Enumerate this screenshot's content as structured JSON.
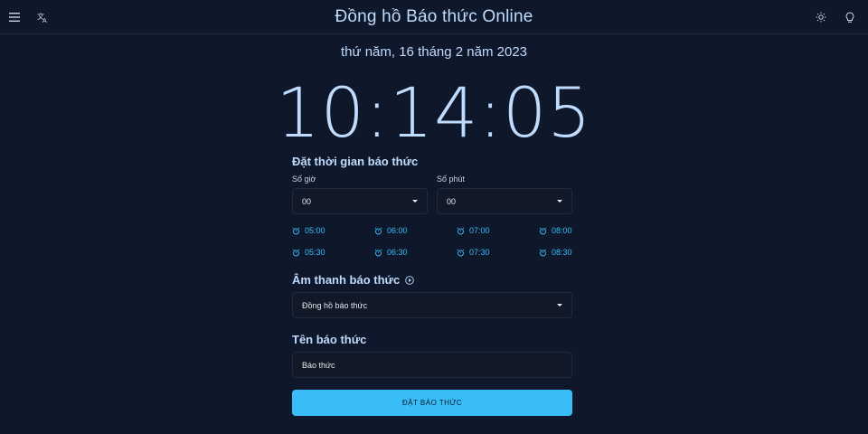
{
  "header": {
    "title": "Đồng hồ Báo thức Online",
    "icons": [
      "menu-icon",
      "translate-icon",
      "sun-icon",
      "lightbulb-icon"
    ]
  },
  "date_line": "thứ năm, 16 tháng 2 năm 2023",
  "clock": "10:14:05",
  "alarm_time": {
    "title": "Đặt thời gian báo thức",
    "hour_label": "Số giờ",
    "hour_value": "00",
    "minute_label": "Số phút",
    "minute_value": "00",
    "presets": [
      "05:00",
      "06:00",
      "07:00",
      "08:00",
      "05:30",
      "06:30",
      "07:30",
      "08:30"
    ]
  },
  "sound": {
    "title": "Âm thanh báo thức",
    "value": "Đồng hồ báo thức"
  },
  "name": {
    "title": "Tên báo thức",
    "value": "Báo thức"
  },
  "submit_label": "ĐẶT BÁO THỨC",
  "colors": {
    "background": "#0f172a",
    "accent": "#38bdf8",
    "text": "#bfdbfe"
  }
}
